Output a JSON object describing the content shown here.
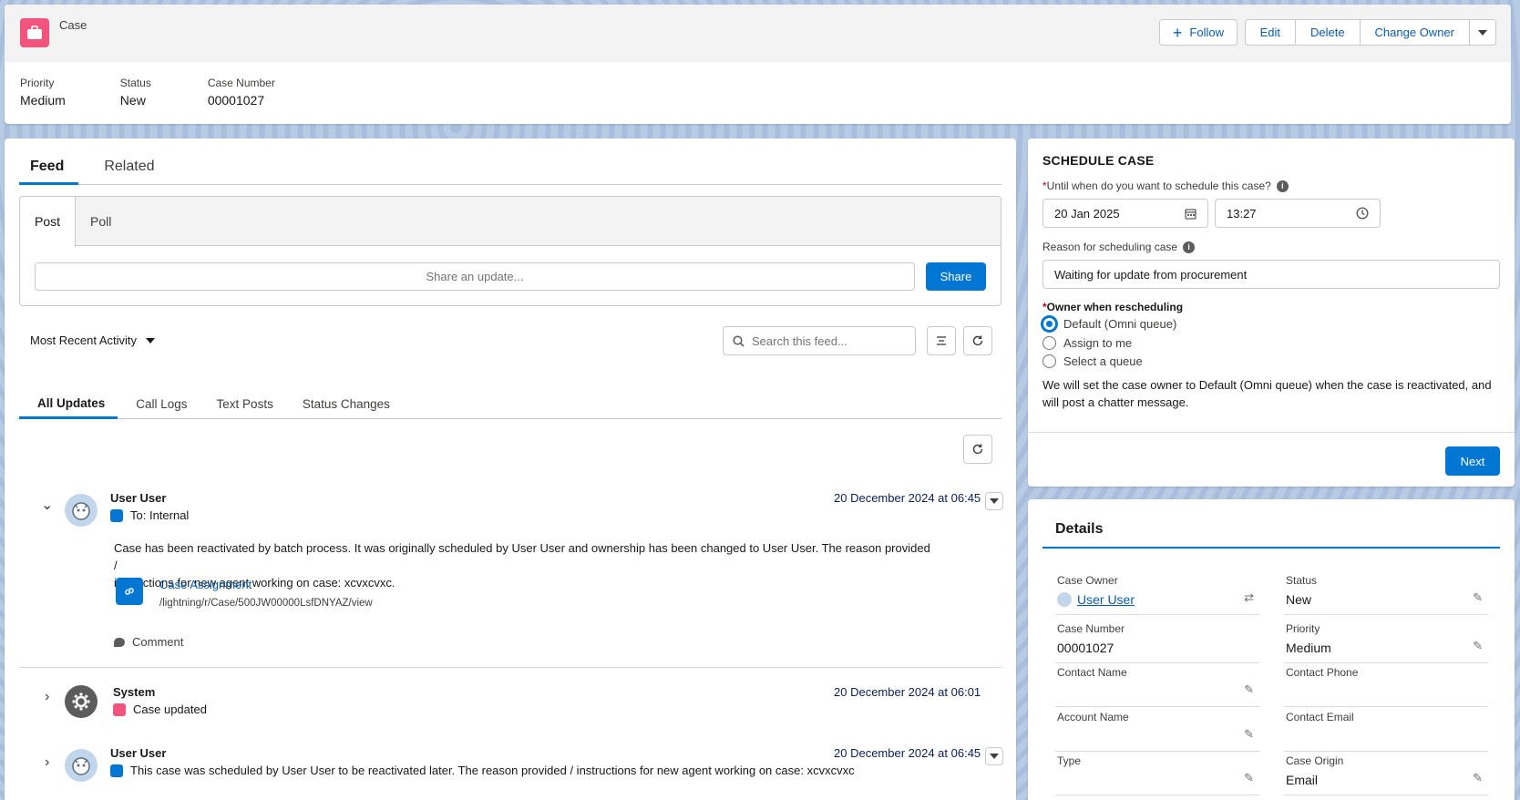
{
  "header": {
    "object_label": "Case",
    "follow_label": "Follow",
    "actions": [
      "Edit",
      "Delete",
      "Change Owner"
    ],
    "highlights": [
      {
        "label": "Priority",
        "value": "Medium"
      },
      {
        "label": "Status",
        "value": "New"
      },
      {
        "label": "Case Number",
        "value": "00001027"
      }
    ]
  },
  "feed": {
    "tabs": [
      "Feed",
      "Related"
    ],
    "publisher_tabs": [
      "Post",
      "Poll"
    ],
    "share_placeholder": "Share an update...",
    "share_label": "Share",
    "sort_label": "Most Recent Activity",
    "search_placeholder": "Search this feed...",
    "filter_tabs": [
      "All Updates",
      "Call Logs",
      "Text Posts",
      "Status Changes"
    ],
    "items": [
      {
        "author": "User User",
        "date": "20 December 2024 at 06:45",
        "sub": "To: Internal",
        "text_line1": "Case has been reactivated by batch process. It was originally scheduled by User User and ownership has been changed to User User. The reason provided /",
        "text_line2": "instructions for new agent working on case: xcvxcvxc.",
        "link_title": "Case Assignment",
        "link_url": "/lightning/r/Case/500JW00000LsfDNYAZ/view",
        "comment_label": "Comment"
      },
      {
        "author": "System",
        "date": "20 December 2024 at 06:01",
        "sub": "Case updated"
      },
      {
        "author": "User User",
        "date": "20 December 2024 at 06:45",
        "sub": "This case was scheduled by User User to be reactivated later. The reason provided / instructions for new agent working on case: xcvxcvxc"
      }
    ]
  },
  "schedule": {
    "title": "SCHEDULE CASE",
    "until_label": "Until when do you want to schedule this case?",
    "date_value": "20 Jan 2025",
    "time_value": "13:27",
    "reason_label": "Reason for scheduling case",
    "reason_value": "Waiting for update from procurement",
    "owner_label": "Owner when rescheduling",
    "owner_options": [
      "Default (Omni queue)",
      "Assign to me",
      "Select a queue"
    ],
    "selected_option": "Default (Omni queue)",
    "note_line1": "We will set the case owner to Default (Omni queue) when the case is reactivated, and",
    "note_line2": "will post a chatter message.",
    "next_label": "Next"
  },
  "details": {
    "title": "Details",
    "fields": [
      {
        "label": "Case Owner",
        "value": "User User"
      },
      {
        "label": "Status",
        "value": "New"
      },
      {
        "label": "Case Number",
        "value": "00001027"
      },
      {
        "label": "Priority",
        "value": "Medium"
      },
      {
        "label": "Contact Name",
        "value": ""
      },
      {
        "label": "Contact Phone",
        "value": ""
      },
      {
        "label": "Account Name",
        "value": ""
      },
      {
        "label": "Contact Email",
        "value": ""
      },
      {
        "label": "Type",
        "value": ""
      },
      {
        "label": "Case Origin",
        "value": "Email"
      }
    ]
  },
  "colors": {
    "brand": "#0176d3",
    "case_icon": "#f2547e",
    "link": "#0b5cab"
  }
}
